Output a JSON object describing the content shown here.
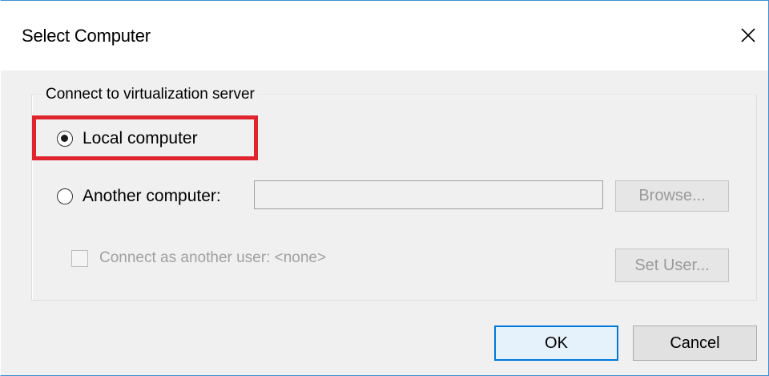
{
  "window": {
    "title": "Select Computer",
    "close_icon": "close-icon"
  },
  "group": {
    "legend": "Connect to virtualization server",
    "options": [
      {
        "label": "Local computer",
        "selected": true
      },
      {
        "label": "Another computer:",
        "selected": false
      }
    ],
    "another_computer_value": "",
    "browse_label": "Browse...",
    "connect_as_label": "Connect as another user: <none>",
    "connect_as_checked": false,
    "set_user_label": "Set User..."
  },
  "footer": {
    "ok_label": "OK",
    "cancel_label": "Cancel"
  },
  "colors": {
    "highlight": "#e0242e",
    "accent": "#0078d7"
  }
}
